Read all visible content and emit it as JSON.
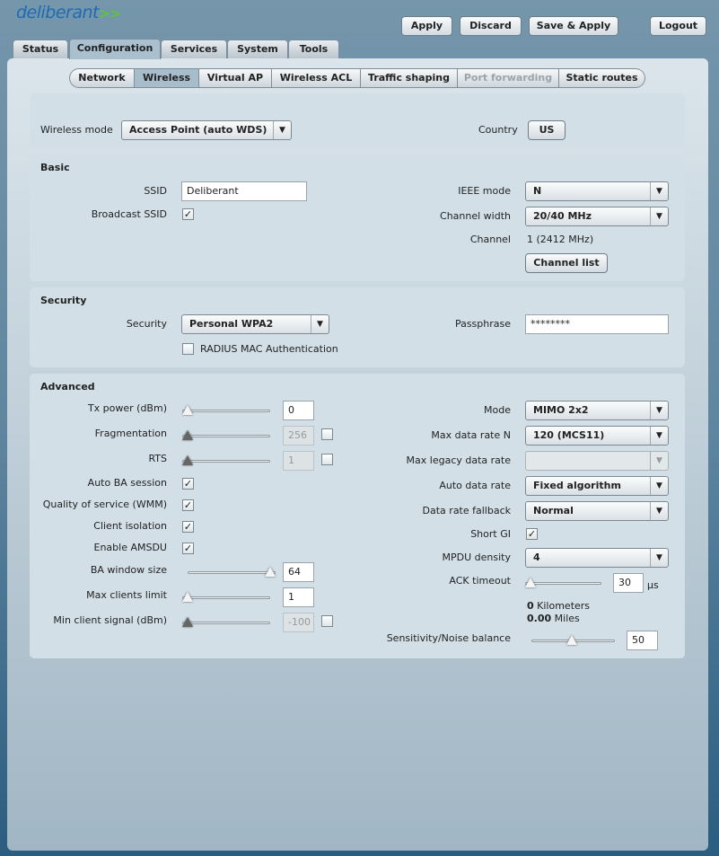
{
  "brand": {
    "logo": "deliberant"
  },
  "top_buttons": {
    "apply": "Apply",
    "discard": "Discard",
    "save_apply": "Save & Apply",
    "logout": "Logout"
  },
  "main_tabs": [
    "Status",
    "Configuration",
    "Services",
    "System",
    "Tools"
  ],
  "sub_tabs": [
    "Network",
    "Wireless",
    "Virtual AP",
    "Wireless ACL",
    "Traffic shaping",
    "Port forwarding",
    "Static routes"
  ],
  "general": {
    "wireless_mode_label": "Wireless mode",
    "wireless_mode": "Access Point (auto WDS)",
    "country_label": "Country",
    "country": "US"
  },
  "basic": {
    "title": "Basic",
    "ssid_label": "SSID",
    "ssid": "Deliberant",
    "broadcast_label": "Broadcast SSID",
    "broadcast": true,
    "ieee_label": "IEEE mode",
    "ieee": "N",
    "width_label": "Channel width",
    "width": "20/40 MHz",
    "channel_label": "Channel",
    "channel": "1 (2412 MHz)",
    "channel_list": "Channel list"
  },
  "security": {
    "title": "Security",
    "security_label": "Security",
    "security": "Personal WPA2",
    "passphrase_label": "Passphrase",
    "passphrase": "********",
    "radius_label": "RADIUS MAC Authentication",
    "radius": false
  },
  "advanced": {
    "title": "Advanced",
    "tx_label": "Tx power (dBm)",
    "tx": "0",
    "frag_label": "Fragmentation",
    "frag": "256",
    "rts_label": "RTS",
    "rts": "1",
    "autoba_label": "Auto BA session",
    "qos_label": "Quality of service (WMM)",
    "iso_label": "Client isolation",
    "amsdu_label": "Enable AMSDU",
    "baw_label": "BA window size",
    "baw": "64",
    "maxc_label": "Max clients limit",
    "maxc": "1",
    "mins_label": "Min client signal (dBm)",
    "mins": "-100",
    "mode_label": "Mode",
    "mode": "MIMO 2x2",
    "rate_label": "Max data rate N",
    "rate": "120 (MCS11)",
    "legacy_label": "Max legacy data rate",
    "legacy": "",
    "auto_label": "Auto data rate",
    "auto": "Fixed algorithm",
    "fallback_label": "Data rate fallback",
    "fallback": "Normal",
    "sgi_label": "Short GI",
    "mpdu_label": "MPDU density",
    "mpdu": "4",
    "ack_label": "ACK timeout",
    "ack": "30",
    "ack_unit": "µs",
    "km": "0",
    "km_unit": "Kilometers",
    "miles": "0.00",
    "miles_unit": "Miles",
    "sens_label": "Sensitivity/Noise balance",
    "sens": "50"
  },
  "icons": {
    "check": "✓",
    "dropdown": "▼"
  }
}
